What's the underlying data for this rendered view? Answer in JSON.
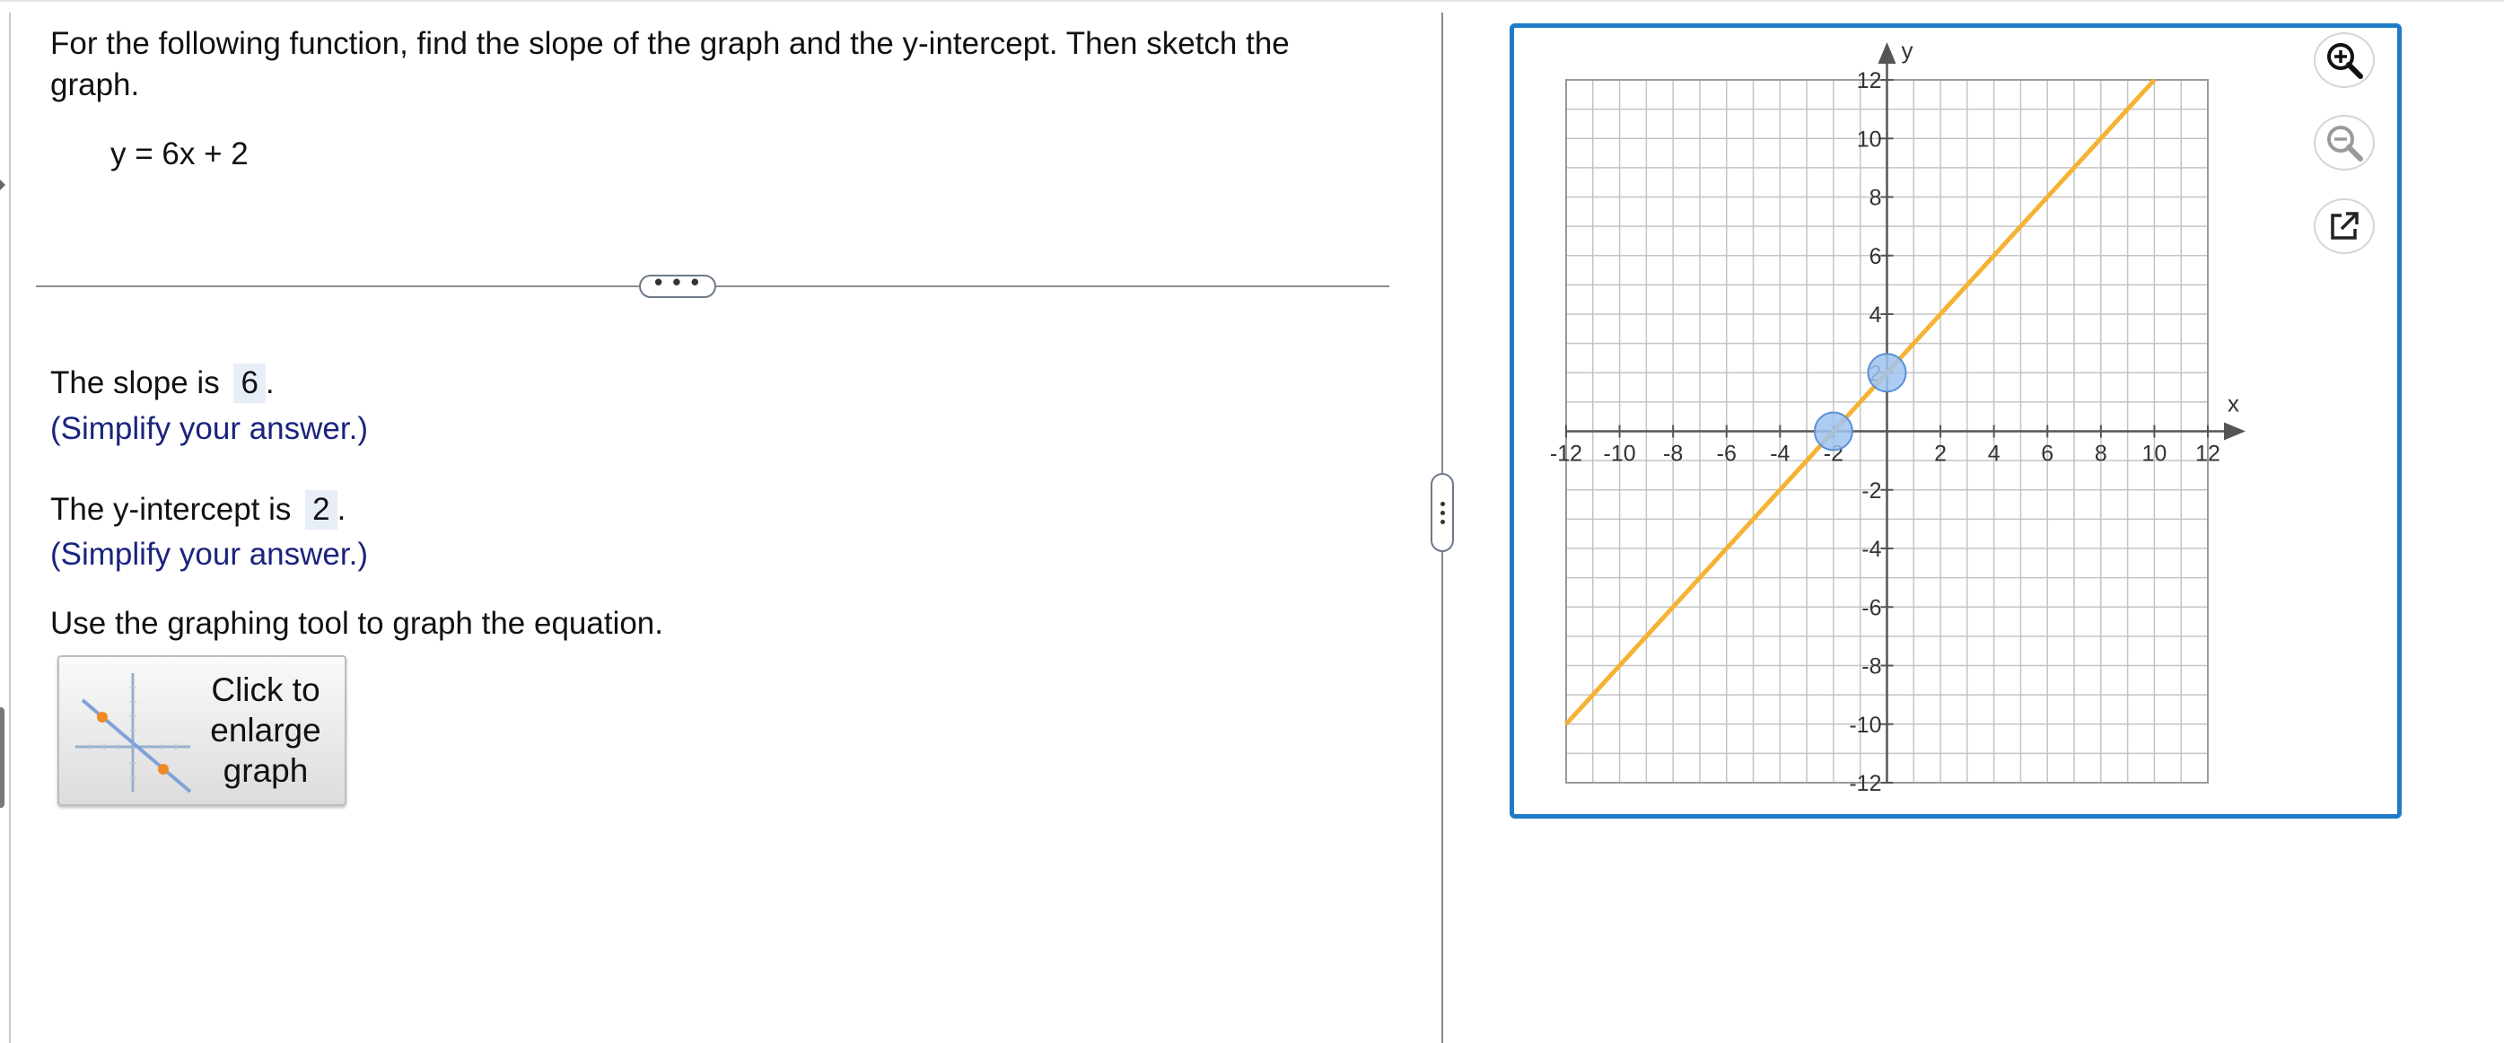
{
  "question": {
    "prompt": "For the following function, find the slope of the graph and the y-intercept. Then sketch the graph.",
    "equation": "y = 6x + 2"
  },
  "divider": {
    "ellipsis_label": "• • •"
  },
  "answers": {
    "slope_prefix": "The slope is",
    "slope_value": "6",
    "slope_suffix": ".",
    "slope_hint": "(Simplify your answer.)",
    "intercept_prefix": "The y-intercept is",
    "intercept_value": "2",
    "intercept_suffix": ".",
    "intercept_hint": "(Simplify your answer.)"
  },
  "instruction": "Use the graphing tool to graph the equation.",
  "enlarge_button": {
    "label_line1": "Click to",
    "label_line2": "enlarge",
    "label_line3": "graph",
    "icon": "graph-thumbnail-icon"
  },
  "graph_tools": {
    "zoom_in_icon": "zoom-in-icon",
    "zoom_out_icon": "zoom-out-icon",
    "popout_icon": "external-link-icon"
  },
  "colors": {
    "frame": "#1f7bc8",
    "line": "#f5b335",
    "point_fill": "#9fc3ee",
    "point_stroke": "#5b8fd6",
    "hint": "#1a237e",
    "answer_box": "#e8eef8"
  },
  "chart_data": {
    "type": "line",
    "xlabel": "x",
    "ylabel": "y",
    "xlim": [
      -12,
      12
    ],
    "ylim": [
      -12,
      12
    ],
    "grid": true,
    "grid_step": 1,
    "x_ticks": [
      -12,
      -10,
      -8,
      -6,
      -4,
      -2,
      2,
      4,
      6,
      8,
      10,
      12
    ],
    "y_ticks": [
      12,
      10,
      8,
      6,
      4,
      2,
      -2,
      -4,
      -6,
      -8,
      -10,
      -12
    ],
    "series": [
      {
        "slope": 6,
        "intercept": 2,
        "points": [
          [
            -12,
            -10
          ],
          [
            10,
            12
          ]
        ]
      }
    ],
    "plotted_points": [
      [
        0,
        2
      ],
      [
        -2,
        0
      ]
    ]
  }
}
